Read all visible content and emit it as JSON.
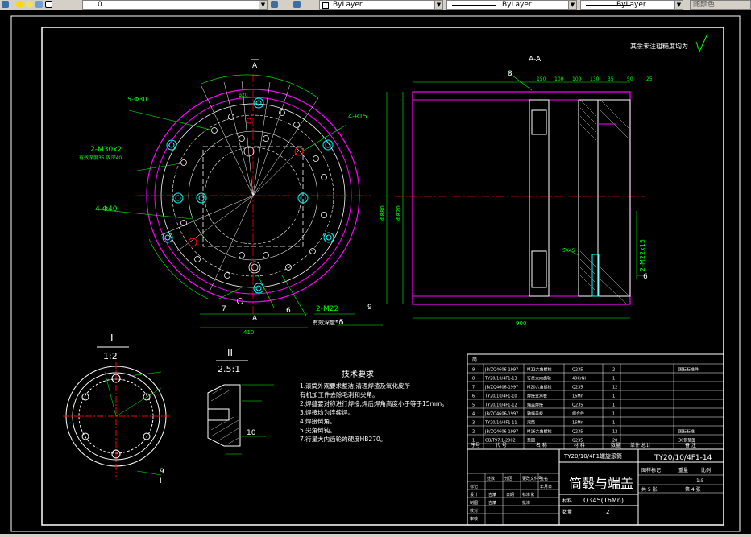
{
  "toolbar": {
    "layer_value": "0",
    "color_label": "ByLayer",
    "linetype_label": "ByLayer",
    "lineweight_label": "ByLayer",
    "plotstyle_label": "随颜色"
  },
  "drawing": {
    "roughness_note": "其余未注粗糙度均为",
    "section_label": "A-A",
    "section_marker": "A",
    "main_view": {
      "label_holes": "5-Φ30",
      "label_r15": "4-R15",
      "label_m30": "2-M30x2",
      "label_m30_sub": "有效深度35 攻深40",
      "label_d40": "4-Φ40",
      "label_m22": "2-M22",
      "label_depth": "有效深度50",
      "label_7": "7",
      "label_6": "6",
      "label_9": "9",
      "label_5": "5",
      "dim_width": "410",
      "dim_top": "φ20",
      "label_a_top": "A",
      "label_a_bottom": "A"
    },
    "section_view": {
      "label_8": "8",
      "dim_bottom": "900",
      "dim_right_m22": "2-M22x15",
      "label_6": "6",
      "dim_chamfer": "5X45",
      "dim_dia": "Φ820",
      "dim_dia2": "Φ880",
      "dim_top_dims": [
        "150",
        "100",
        "100",
        "130",
        "35",
        "50",
        "25"
      ]
    },
    "detail_1": {
      "roman": "I",
      "scale": "1:2",
      "label_9": "9",
      "label_I": "I"
    },
    "detail_2": {
      "roman": "II",
      "scale": "2.5:1",
      "label_10": "10"
    },
    "tech_req": {
      "title": "技术要求",
      "lines": [
        "1.滚筒外观要求整洁,清理焊渣及氧化皮所",
        "  有机加工件去除毛刺和尖角。",
        "2.焊缝要对称进行焊接,焊后焊角高度小于等于15mm。",
        "3.焊接均为连续焊。",
        "4.焊接倒角。",
        "5.尖角倒钝。",
        "7.行星大内齿轮的硬度HB270。"
      ]
    },
    "bom": {
      "header_no": "序号",
      "header_code": "代  号",
      "header_name": "名  称",
      "header_qty": "数量",
      "header_mat": "材  料",
      "header_weight": "单件 总计",
      "header_note": "备  注",
      "header_top": "简",
      "rows": [
        {
          "no": "9",
          "code": "JB/ZQ4606-1997",
          "name": "M22六角螺栓",
          "mat": "Q235",
          "qty": "2",
          "note": "国标标准件"
        },
        {
          "no": "8",
          "code": "TY20/10/4F1-13",
          "name": "行星大内齿轮",
          "mat": "40CrNi",
          "qty": "1",
          "note": ""
        },
        {
          "no": "7",
          "code": "JB/ZQ4606-1997",
          "name": "M20六角螺栓",
          "mat": "Q235",
          "qty": "12",
          "note": ""
        },
        {
          "no": "6",
          "code": "TY20/10/4F1-10",
          "name": "焊接支承板",
          "mat": "16Mn",
          "qty": "1",
          "note": ""
        },
        {
          "no": "5",
          "code": "TY20/10/4F1-12",
          "name": "端盖焊接",
          "mat": "Q235",
          "qty": "1",
          "note": ""
        },
        {
          "no": "4",
          "code": "JB/ZQ4606-1997",
          "name": "轴端盖板",
          "mat": "组合件",
          "qty": "1",
          "note": ""
        },
        {
          "no": "3",
          "code": "TY20/10/4F1-11",
          "name": "滚筒",
          "mat": "16Mn",
          "qty": "1",
          "note": ""
        },
        {
          "no": "2",
          "code": "JB/ZQ4606-1997",
          "name": "M16六角螺栓",
          "mat": "Q235",
          "qty": "12",
          "note": "国标标准"
        },
        {
          "no": "1",
          "code": "GB/T97.1-2002",
          "name": "垫圈",
          "mat": "Q235",
          "qty": "20",
          "note": "30钢垫圈"
        }
      ]
    },
    "title_block": {
      "subtitle": "TY20/10/4F1螺旋滚筒",
      "drawing_no": "TY20/10/4F1-14",
      "title": "筒毂与端盖",
      "material_label": "材料",
      "material": "Q345(16Mn)",
      "qty_label": "数量",
      "qty": "2",
      "stage_label": "图样标记",
      "weight_label": "重量",
      "scale_label": "比例",
      "scale": "1:5",
      "sheet_label": "共 5 张",
      "sheet_of": "第 4 张",
      "row_labels": [
        "标记",
        "设计",
        "制图",
        "校对",
        "审核"
      ],
      "names": [
        "",
        "吉斌",
        "吉斌",
        "",
        ""
      ],
      "dates": [
        "",
        "日期",
        "",
        "",
        ""
      ],
      "count_label": "处数",
      "part_label": "分区",
      "doc_label": "更改文件号",
      "sign_label": "签名",
      "date_label": "年月日",
      "std_label": "标准化",
      "approve_label": "批准"
    }
  },
  "colors": {
    "background": "#000000",
    "frame": "#ffffff",
    "green": "#00ff00",
    "magenta": "#ff00ff",
    "red": "#ff0000",
    "cyan": "#00ffff",
    "yellow": "#ffff00"
  }
}
